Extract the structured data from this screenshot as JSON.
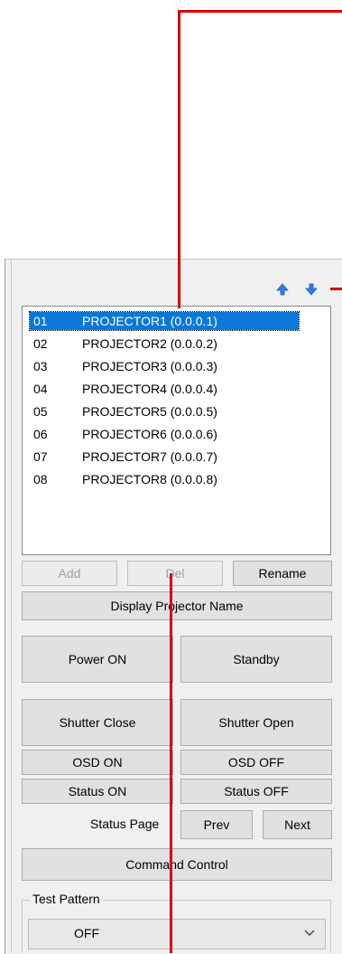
{
  "list": {
    "items": [
      {
        "num": "01",
        "name": "PROJECTOR1 (0.0.0.1)",
        "selected": true
      },
      {
        "num": "02",
        "name": "PROJECTOR2 (0.0.0.2)"
      },
      {
        "num": "03",
        "name": "PROJECTOR3 (0.0.0.3)"
      },
      {
        "num": "04",
        "name": "PROJECTOR4 (0.0.0.4)"
      },
      {
        "num": "05",
        "name": "PROJECTOR5 (0.0.0.5)"
      },
      {
        "num": "06",
        "name": "PROJECTOR6 (0.0.0.6)"
      },
      {
        "num": "07",
        "name": "PROJECTOR7 (0.0.0.7)"
      },
      {
        "num": "08",
        "name": "PROJECTOR8 (0.0.0.8)"
      }
    ]
  },
  "buttons": {
    "add": "Add",
    "del": "Del",
    "rename": "Rename",
    "display_name": "Display Projector Name",
    "power_on": "Power ON",
    "standby": "Standby",
    "shutter_close": "Shutter Close",
    "shutter_open": "Shutter Open",
    "osd_on": "OSD ON",
    "osd_off": "OSD OFF",
    "status_on": "Status ON",
    "status_off": "Status OFF",
    "prev": "Prev",
    "next": "Next",
    "command_control": "Command Control"
  },
  "labels": {
    "status_page": "Status Page",
    "test_pattern": "Test Pattern"
  },
  "test_pattern": {
    "value": "OFF"
  },
  "icons": {
    "move_up": "arrow-up-icon",
    "move_down": "arrow-down-icon",
    "dropdown": "chevron-down-icon"
  },
  "colors": {
    "selection": "#0a78d7",
    "callout": "#d90000",
    "arrow": "#2f7de1"
  }
}
